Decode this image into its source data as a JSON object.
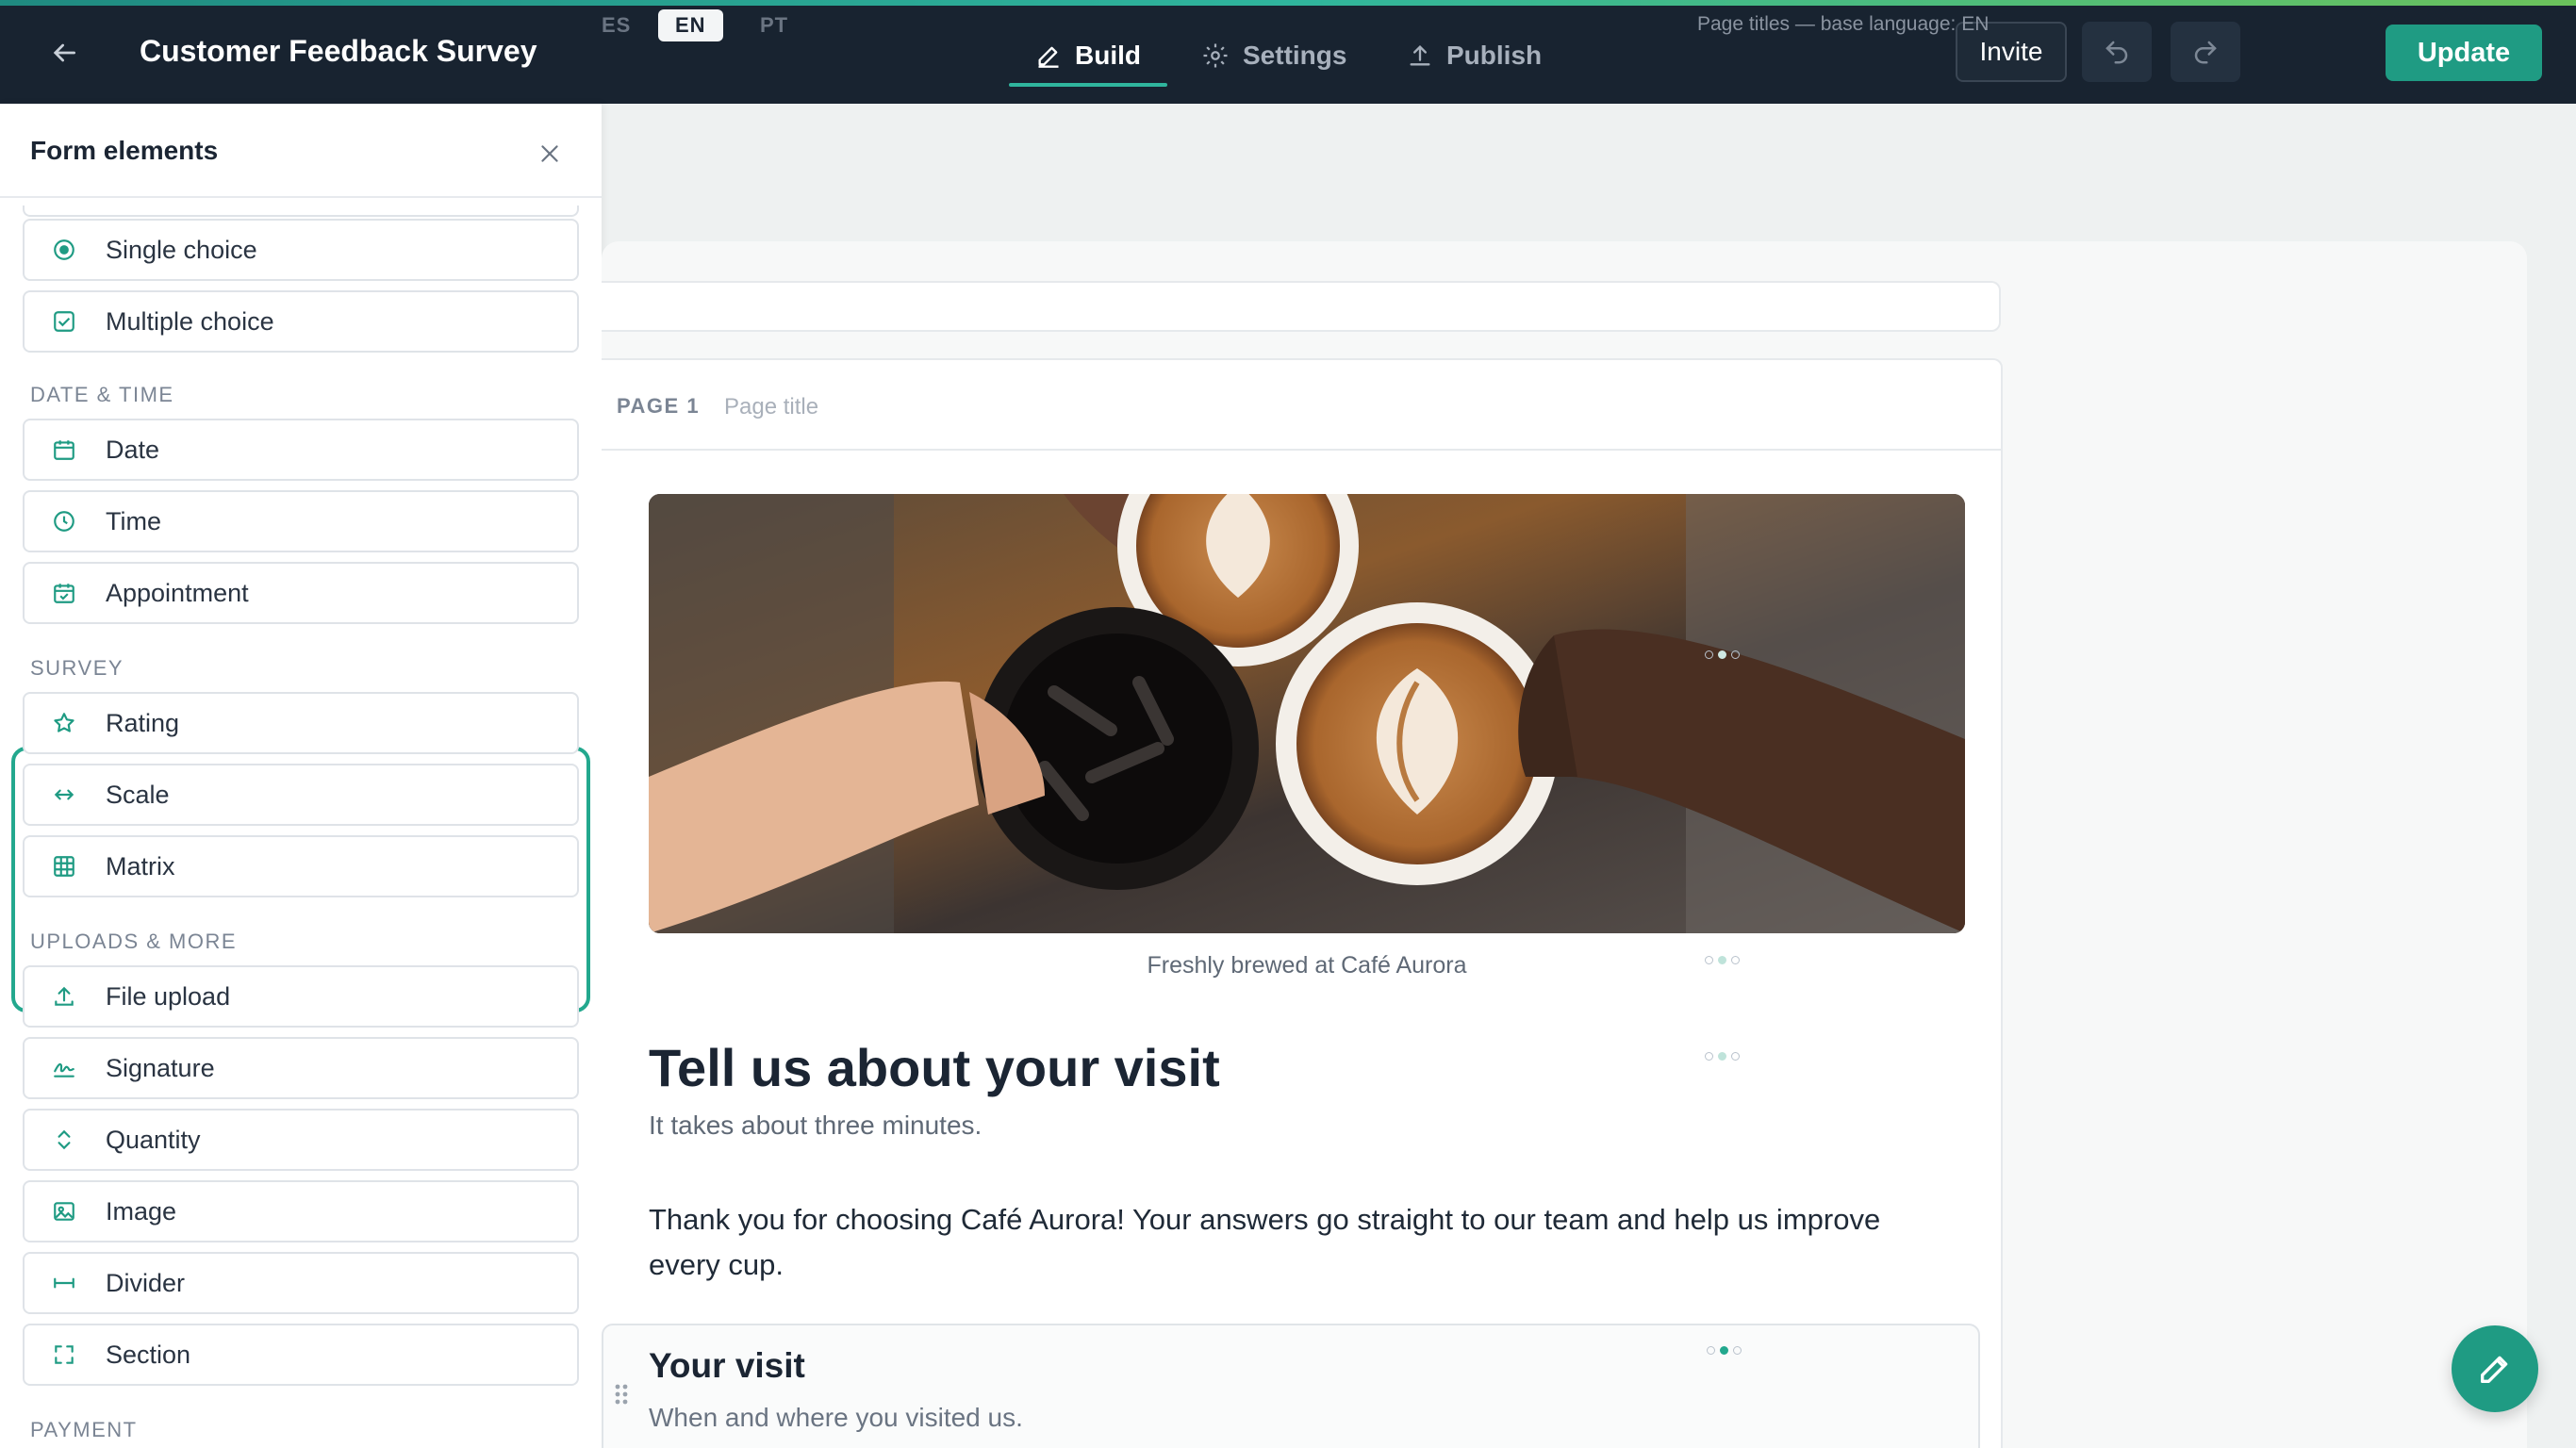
{
  "header": {
    "title": "Customer Feedback Survey",
    "tabs": {
      "build": "Build",
      "settings": "Settings",
      "publish": "Publish"
    },
    "invite_label": "Invite",
    "update_label": "Update",
    "accent_color": "#1f9b83"
  },
  "sidebar": {
    "title": "Form elements",
    "items_top": [
      {
        "label": "Single choice",
        "icon": "radio-icon"
      },
      {
        "label": "Multiple choice",
        "icon": "checkbox-icon"
      }
    ],
    "sections": {
      "date_time": "DATE & TIME",
      "survey": "SURVEY",
      "uploads": "UPLOADS & MORE",
      "payment": "PAYMENT"
    },
    "date_time_items": [
      {
        "label": "Date",
        "icon": "calendar-icon"
      },
      {
        "label": "Time",
        "icon": "clock-icon"
      },
      {
        "label": "Appointment",
        "icon": "calendar-check-icon"
      }
    ],
    "survey_items": [
      {
        "label": "Rating",
        "icon": "star-icon"
      },
      {
        "label": "Scale",
        "icon": "arrows-horizontal-icon"
      },
      {
        "label": "Matrix",
        "icon": "grid-icon"
      }
    ],
    "upload_items": [
      {
        "label": "File upload",
        "icon": "upload-icon"
      },
      {
        "label": "Signature",
        "icon": "signature-icon"
      },
      {
        "label": "Quantity",
        "icon": "chevrons-updown-icon"
      },
      {
        "label": "Image",
        "icon": "image-icon"
      },
      {
        "label": "Divider",
        "icon": "divider-icon"
      },
      {
        "label": "Section",
        "icon": "section-icon"
      }
    ]
  },
  "languages": {
    "items": [
      "ES",
      "EN",
      "PT"
    ],
    "active": "EN",
    "note": "Page titles — base language: EN"
  },
  "page": {
    "label": "PAGE 1",
    "title_placeholder": "Page title",
    "image_caption": "Freshly brewed at Café Aurora",
    "heading": "Tell us about your visit",
    "subheading": "It takes about three minutes.",
    "body": "Thank you for choosing Café Aurora! Your answers go straight to our team and help us improve every cup.",
    "section": {
      "title": "Your visit",
      "subtitle": "When and where you visited us."
    }
  }
}
